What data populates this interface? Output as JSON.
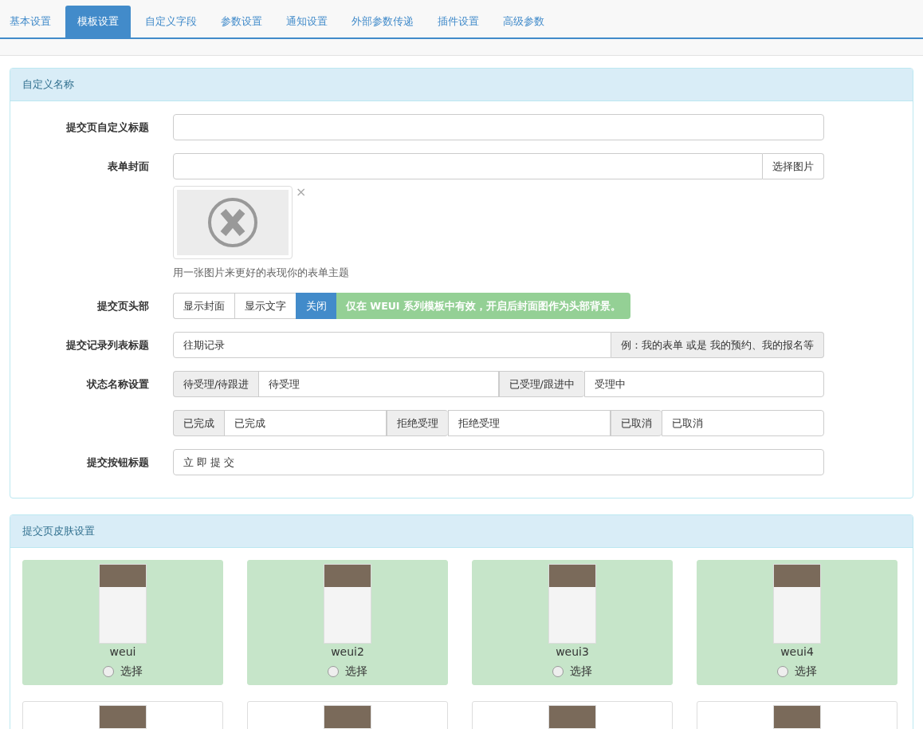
{
  "tabs": [
    {
      "label": "基本设置",
      "selected": false
    },
    {
      "label": "模板设置",
      "selected": true
    },
    {
      "label": "自定义字段",
      "selected": false
    },
    {
      "label": "参数设置",
      "selected": false
    },
    {
      "label": "通知设置",
      "selected": false
    },
    {
      "label": "外部参数传递",
      "selected": false
    },
    {
      "label": "插件设置",
      "selected": false
    },
    {
      "label": "高级参数",
      "selected": false
    }
  ],
  "custom_names": {
    "title": "自定义名称",
    "submit_title": {
      "label": "提交页自定义标题"
    },
    "cover": {
      "label": "表单封面",
      "button": "选择图片",
      "remove": "×",
      "help": "用一张图片来更好的表现你的表单主题"
    },
    "header": {
      "label": "提交页头部",
      "options": [
        {
          "label": "显示封面",
          "selected": false
        },
        {
          "label": "显示文字",
          "selected": false
        },
        {
          "label": "关闭",
          "selected": true
        }
      ],
      "note": "仅在 WEUI 系列模板中有效，开启后封面图作为头部背景。"
    },
    "record_title": {
      "label": "提交记录列表标题",
      "value": "往期记录",
      "addon": "例：我的表单 或是 我的预约、我的报名等"
    },
    "status": {
      "label": "状态名称设置",
      "rows": [
        [
          {
            "addon": "待受理/待跟进",
            "value": "待受理"
          },
          {
            "addon": "已受理/跟进中",
            "value": "受理中"
          }
        ],
        [
          {
            "addon": "已完成",
            "value": "已完成"
          },
          {
            "addon": "拒绝受理",
            "value": "拒绝受理"
          },
          {
            "addon": "已取消",
            "value": "已取消"
          }
        ]
      ]
    },
    "button_title": {
      "label": "提交按钮标题",
      "value": "立 即 提 交"
    }
  },
  "skins": {
    "title": "提交页皮肤设置",
    "items": [
      {
        "name": "weui",
        "option": "选择",
        "selected": false,
        "highlighted": true
      },
      {
        "name": "weui2",
        "option": "选择",
        "selected": false,
        "highlighted": true
      },
      {
        "name": "weui3",
        "option": "选择",
        "selected": false,
        "highlighted": true
      },
      {
        "name": "weui4",
        "option": "选择",
        "selected": false,
        "highlighted": true
      },
      {
        "highlighted": false
      },
      {
        "highlighted": false
      },
      {
        "highlighted": false
      },
      {
        "highlighted": false
      }
    ]
  }
}
